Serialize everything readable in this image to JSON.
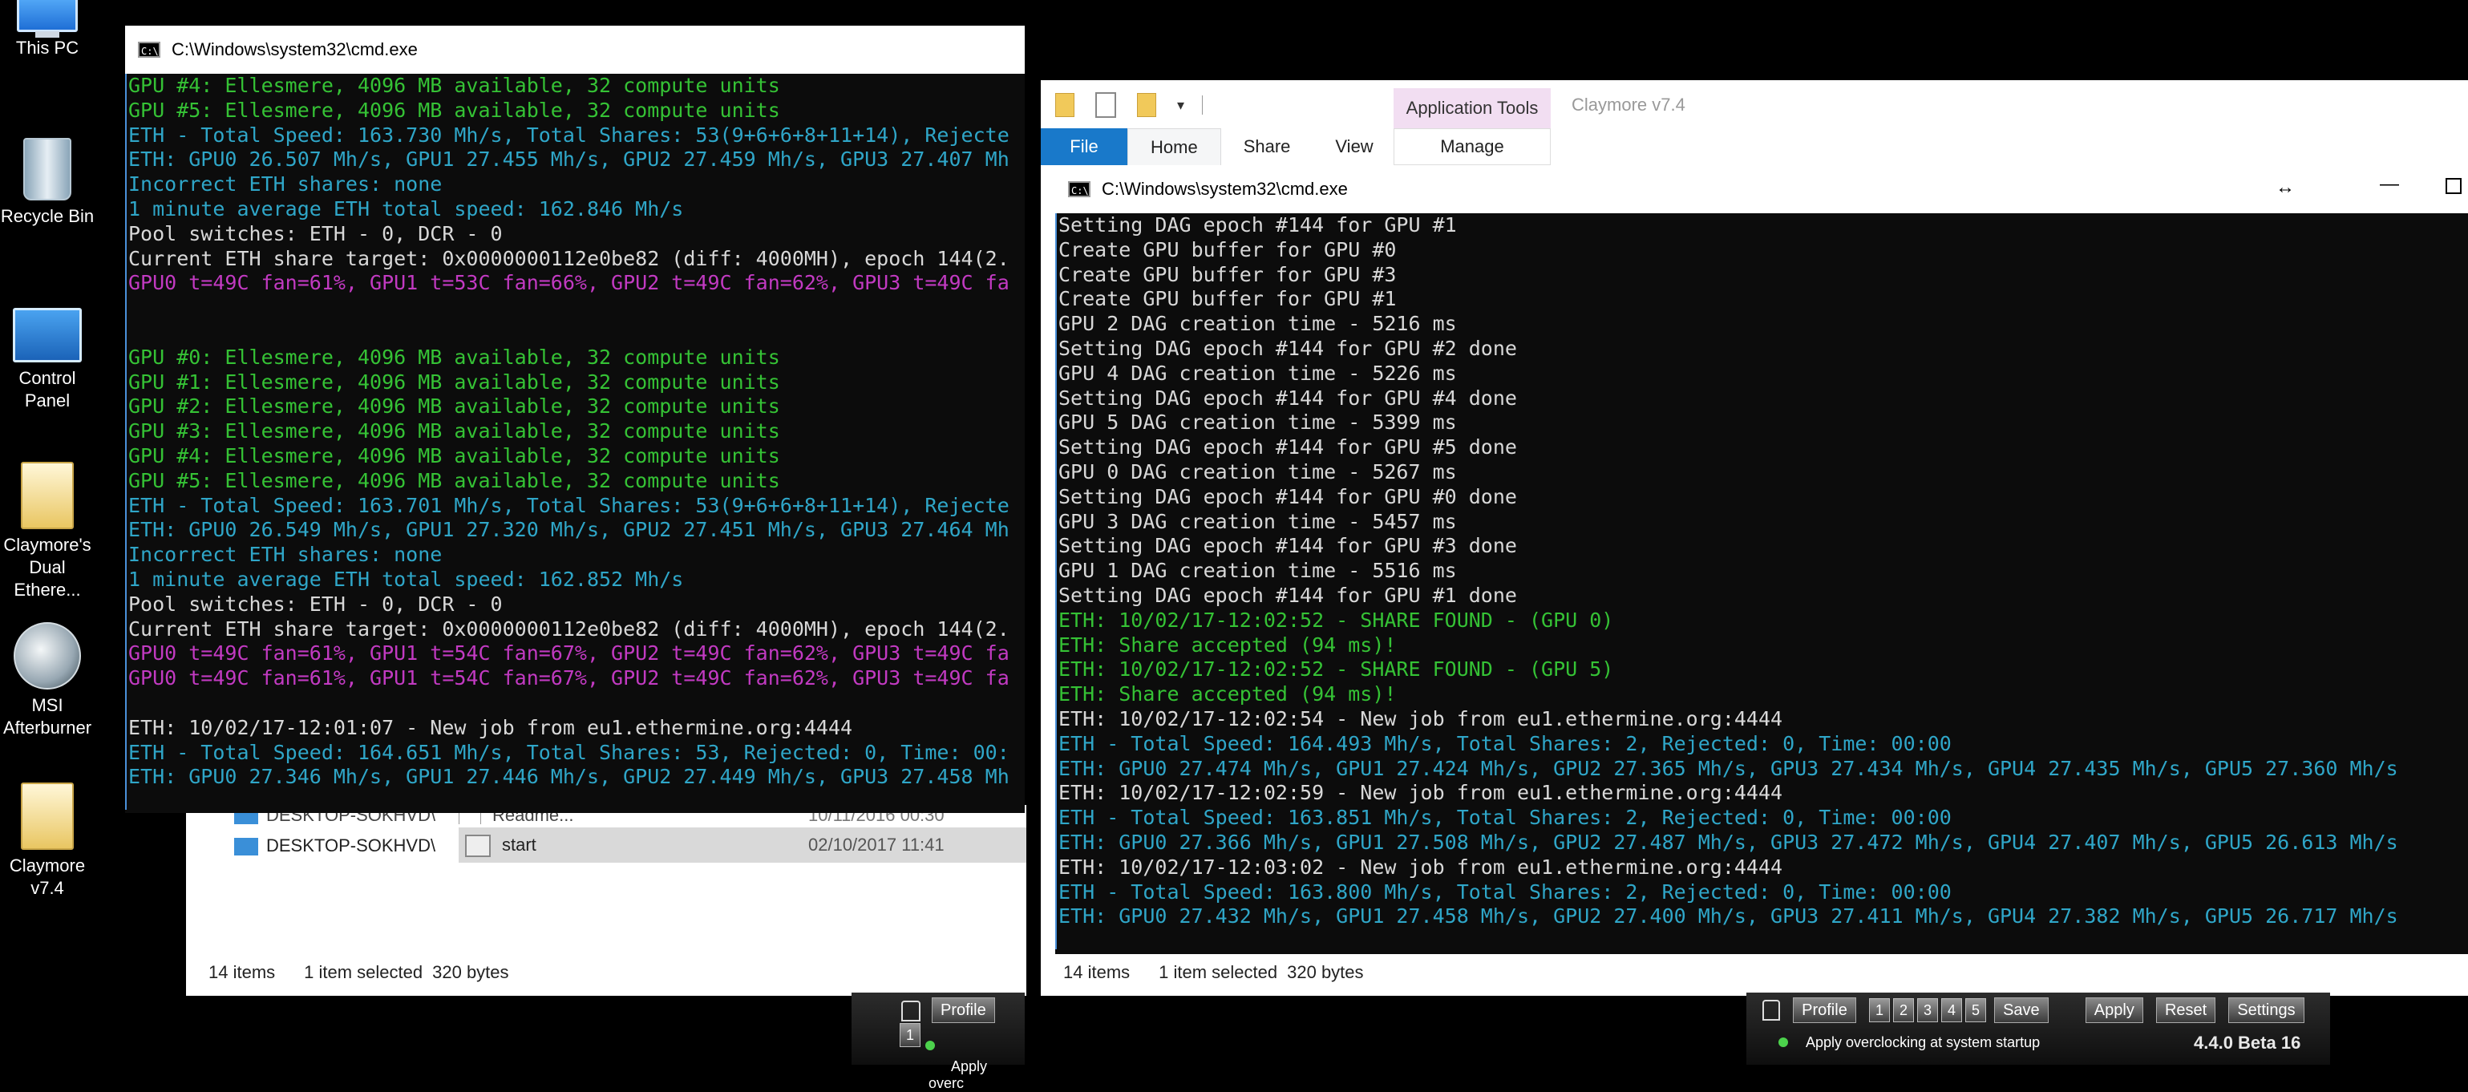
{
  "desktop_icons": [
    {
      "label": "This PC",
      "icon": "computer-icon"
    },
    {
      "label": "Recycle Bin",
      "icon": "recycle-bin-icon"
    },
    {
      "label": "Control Panel",
      "icon": "control-panel-icon"
    },
    {
      "label": "Claymore's Dual Ethere...",
      "icon": "folder-icon"
    },
    {
      "label": "MSI Afterburner",
      "icon": "afterburner-icon"
    },
    {
      "label": "Claymore v7.4",
      "icon": "folder-icon"
    }
  ],
  "cmd_left": {
    "title": "C:\\Windows\\system32\\cmd.exe",
    "lines": [
      {
        "t": "GPU #4: Ellesmere, 4096 MB available, 32 compute units",
        "c": "green"
      },
      {
        "t": "GPU #5: Ellesmere, 4096 MB available, 32 compute units",
        "c": "green"
      },
      {
        "t": "ETH - Total Speed: 163.730 Mh/s, Total Shares: 53(9+6+6+8+11+14), Rejecte",
        "c": "cyan"
      },
      {
        "t": "ETH: GPU0 26.507 Mh/s, GPU1 27.455 Mh/s, GPU2 27.459 Mh/s, GPU3 27.407 Mh",
        "c": "cyan"
      },
      {
        "t": "Incorrect ETH shares: none",
        "c": "cyan"
      },
      {
        "t": "1 minute average ETH total speed: 162.846 Mh/s",
        "c": "cyan"
      },
      {
        "t": "Pool switches: ETH - 0, DCR - 0",
        "c": "white"
      },
      {
        "t": "Current ETH share target: 0x0000000112e0be82 (diff: 4000MH), epoch 144(2.",
        "c": "white"
      },
      {
        "t": "GPU0 t=49C fan=61%, GPU1 t=53C fan=66%, GPU2 t=49C fan=62%, GPU3 t=49C fa",
        "c": "magenta"
      },
      {
        "t": "",
        "c": "white"
      },
      {
        "t": "",
        "c": "white"
      },
      {
        "t": "GPU #0: Ellesmere, 4096 MB available, 32 compute units",
        "c": "green"
      },
      {
        "t": "GPU #1: Ellesmere, 4096 MB available, 32 compute units",
        "c": "green"
      },
      {
        "t": "GPU #2: Ellesmere, 4096 MB available, 32 compute units",
        "c": "green"
      },
      {
        "t": "GPU #3: Ellesmere, 4096 MB available, 32 compute units",
        "c": "green"
      },
      {
        "t": "GPU #4: Ellesmere, 4096 MB available, 32 compute units",
        "c": "green"
      },
      {
        "t": "GPU #5: Ellesmere, 4096 MB available, 32 compute units",
        "c": "green"
      },
      {
        "t": "ETH - Total Speed: 163.701 Mh/s, Total Shares: 53(9+6+6+8+11+14), Rejecte",
        "c": "cyan"
      },
      {
        "t": "ETH: GPU0 26.549 Mh/s, GPU1 27.320 Mh/s, GPU2 27.451 Mh/s, GPU3 27.464 Mh",
        "c": "cyan"
      },
      {
        "t": "Incorrect ETH shares: none",
        "c": "cyan"
      },
      {
        "t": "1 minute average ETH total speed: 162.852 Mh/s",
        "c": "cyan"
      },
      {
        "t": "Pool switches: ETH - 0, DCR - 0",
        "c": "white"
      },
      {
        "t": "Current ETH share target: 0x0000000112e0be82 (diff: 4000MH), epoch 144(2.",
        "c": "white"
      },
      {
        "t": "GPU0 t=49C fan=61%, GPU1 t=54C fan=67%, GPU2 t=49C fan=62%, GPU3 t=49C fa",
        "c": "magenta"
      },
      {
        "t": "GPU0 t=49C fan=61%, GPU1 t=54C fan=67%, GPU2 t=49C fan=62%, GPU3 t=49C fa",
        "c": "magenta"
      },
      {
        "t": "",
        "c": "white"
      },
      {
        "t": "ETH: 10/02/17-12:01:07 - New job from eu1.ethermine.org:4444",
        "c": "white"
      },
      {
        "t": "ETH - Total Speed: 164.651 Mh/s, Total Shares: 53, Rejected: 0, Time: 00:",
        "c": "cyan"
      },
      {
        "t": "ETH: GPU0 27.346 Mh/s, GPU1 27.446 Mh/s, GPU2 27.449 Mh/s, GPU3 27.458 Mh",
        "c": "cyan"
      }
    ]
  },
  "cmd_right": {
    "title": "C:\\Windows\\system32\\cmd.exe",
    "lines": [
      {
        "t": "Setting DAG epoch #144 for GPU #1",
        "c": "white"
      },
      {
        "t": "Create GPU buffer for GPU #0",
        "c": "white"
      },
      {
        "t": "Create GPU buffer for GPU #3",
        "c": "white"
      },
      {
        "t": "Create GPU buffer for GPU #1",
        "c": "white"
      },
      {
        "t": "GPU 2 DAG creation time - 5216 ms",
        "c": "white"
      },
      {
        "t": "Setting DAG epoch #144 for GPU #2 done",
        "c": "white"
      },
      {
        "t": "GPU 4 DAG creation time - 5226 ms",
        "c": "white"
      },
      {
        "t": "Setting DAG epoch #144 for GPU #4 done",
        "c": "white"
      },
      {
        "t": "GPU 5 DAG creation time - 5399 ms",
        "c": "white"
      },
      {
        "t": "Setting DAG epoch #144 for GPU #5 done",
        "c": "white"
      },
      {
        "t": "GPU 0 DAG creation time - 5267 ms",
        "c": "white"
      },
      {
        "t": "Setting DAG epoch #144 for GPU #0 done",
        "c": "white"
      },
      {
        "t": "GPU 3 DAG creation time - 5457 ms",
        "c": "white"
      },
      {
        "t": "Setting DAG epoch #144 for GPU #3 done",
        "c": "white"
      },
      {
        "t": "GPU 1 DAG creation time - 5516 ms",
        "c": "white"
      },
      {
        "t": "Setting DAG epoch #144 for GPU #1 done",
        "c": "white"
      },
      {
        "t": "ETH: 10/02/17-12:02:52 - SHARE FOUND - (GPU 0)",
        "c": "green"
      },
      {
        "t": "ETH: Share accepted (94 ms)!",
        "c": "green"
      },
      {
        "t": "ETH: 10/02/17-12:02:52 - SHARE FOUND - (GPU 5)",
        "c": "green"
      },
      {
        "t": "ETH: Share accepted (94 ms)!",
        "c": "green"
      },
      {
        "t": "ETH: 10/02/17-12:02:54 - New job from eu1.ethermine.org:4444",
        "c": "white"
      },
      {
        "t": "ETH - Total Speed: 164.493 Mh/s, Total Shares: 2, Rejected: 0, Time: 00:00",
        "c": "cyan"
      },
      {
        "t": "ETH: GPU0 27.474 Mh/s, GPU1 27.424 Mh/s, GPU2 27.365 Mh/s, GPU3 27.434 Mh/s, GPU4 27.435 Mh/s, GPU5 27.360 Mh/s",
        "c": "cyan"
      },
      {
        "t": "ETH: 10/02/17-12:02:59 - New job from eu1.ethermine.org:4444",
        "c": "white"
      },
      {
        "t": "ETH - Total Speed: 163.851 Mh/s, Total Shares: 2, Rejected: 0, Time: 00:00",
        "c": "cyan"
      },
      {
        "t": "ETH: GPU0 27.366 Mh/s, GPU1 27.508 Mh/s, GPU2 27.487 Mh/s, GPU3 27.472 Mh/s, GPU4 27.407 Mh/s, GPU5 26.613 Mh/s",
        "c": "cyan"
      },
      {
        "t": "ETH: 10/02/17-12:03:02 - New job from eu1.ethermine.org:4444",
        "c": "white"
      },
      {
        "t": "ETH - Total Speed: 163.800 Mh/s, Total Shares: 2, Rejected: 0, Time: 00:00",
        "c": "cyan"
      },
      {
        "t": "ETH: GPU0 27.432 Mh/s, GPU1 27.458 Mh/s, GPU2 27.400 Mh/s, GPU3 27.411 Mh/s, GPU4 27.382 Mh/s, GPU5 26.717 Mh/s",
        "c": "cyan"
      }
    ]
  },
  "explorer": {
    "tabs": {
      "file": "File",
      "home": "Home",
      "share": "Share",
      "view": "View"
    },
    "context_group": "Application Tools",
    "context_tab": "Manage",
    "window_title": "Claymore v7.4",
    "status": {
      "items": "14 items",
      "selected": "1 item selected",
      "size": "320 bytes"
    }
  },
  "explorer_left": {
    "nav_item": "DESKTOP-SOKHVD\\",
    "nav_item_partial": "DESKTOP-SOKHVD\\",
    "file_partial": "Readme...",
    "file_partial_date": "10/11/2016 00:30",
    "file_name": "start",
    "file_date": "02/10/2017 11:41",
    "status": {
      "items": "14 items",
      "selected": "1 item selected",
      "size": "320 bytes"
    }
  },
  "afterburner_left": {
    "profile": "Profile",
    "profile_num": "1",
    "startup": "Apply overc"
  },
  "afterburner_right": {
    "profile": "Profile",
    "slots": [
      "1",
      "2",
      "3",
      "4",
      "5"
    ],
    "save": "Save",
    "apply": "Apply",
    "reset": "Reset",
    "settings": "Settings",
    "startup": "Apply overclocking at system startup",
    "version": "4.4.0 Beta 16"
  },
  "colors": {
    "green": "#35c235",
    "cyan": "#2fa6c8",
    "white": "#d8d8d8",
    "magenta": "#c23ac2",
    "file_tab": "#1979ca",
    "context_tab": "#f2def2"
  }
}
